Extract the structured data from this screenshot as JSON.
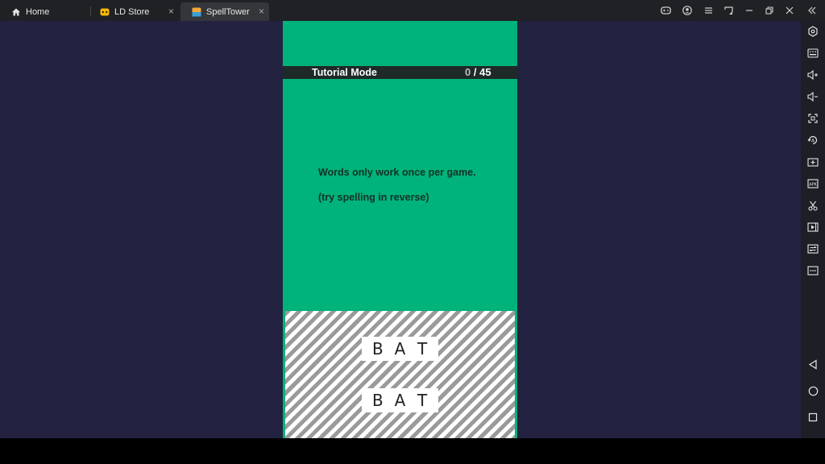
{
  "tabs": [
    {
      "label": "Home",
      "icon": "home-icon",
      "active": false
    },
    {
      "label": "LD Store",
      "icon": "ld-store-icon",
      "active": false,
      "close": "×"
    },
    {
      "label": "SpellTower",
      "icon": "spelltower-icon",
      "active": true,
      "close": "×"
    }
  ],
  "game": {
    "mode_title": "Tutorial Mode",
    "score_current": "0",
    "score_total": "/ 45",
    "message_line1": "Words only work once per game.",
    "message_line2": "(try spelling in reverse)",
    "words": [
      {
        "letters": [
          "B",
          "A",
          "T"
        ]
      },
      {
        "letters": [
          "B",
          "A",
          "T"
        ]
      }
    ]
  },
  "colors": {
    "game_bg": "#00b37a",
    "emulator_bg": "#232241",
    "header_bar": "#1e2a28"
  },
  "sidebar_icons": [
    "settings-icon",
    "keyboard-icon",
    "volume-up-icon",
    "volume-down-icon",
    "fullscreen-icon",
    "rotate-icon",
    "add-app-icon",
    "apk-icon",
    "scissors-icon",
    "record-icon",
    "sync-icon",
    "more-icon",
    "back-icon",
    "home-circle-icon",
    "recent-apps-icon"
  ]
}
